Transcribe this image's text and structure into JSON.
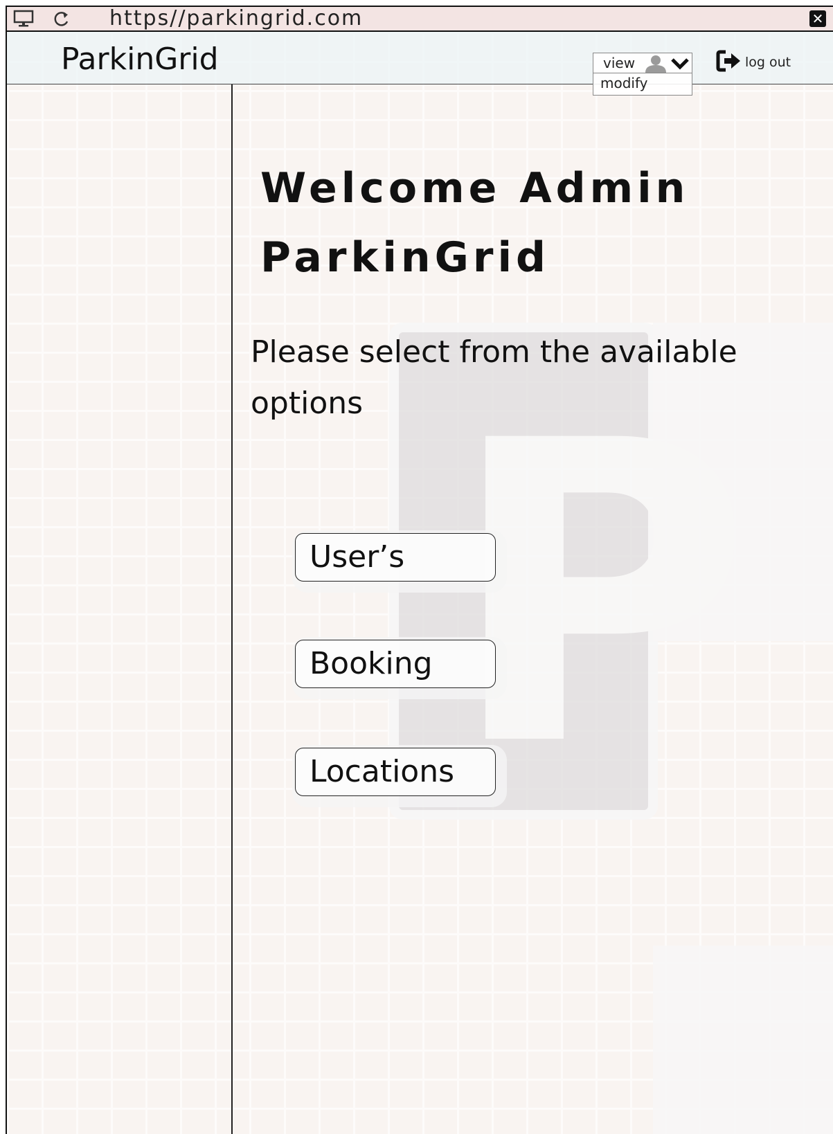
{
  "browser": {
    "url": "https//parkingrid.com"
  },
  "header": {
    "logo": "ParkinGrid",
    "view_dropdown": {
      "selected": "view",
      "options": [
        "modify"
      ]
    },
    "logout_label": "log out"
  },
  "main": {
    "welcome_line1": "Welcome Admin",
    "welcome_line2": "ParkinGrid",
    "instructions": "Please select from the available options",
    "buttons": [
      {
        "label": "User’s"
      },
      {
        "label": "Booking"
      },
      {
        "label": "Locations"
      }
    ]
  },
  "icons": {
    "monitor": "monitor-icon",
    "reload": "reload-icon",
    "close": "close-icon",
    "user": "user-icon",
    "chevron": "chevron-down-icon",
    "logout": "sign-out-icon"
  }
}
